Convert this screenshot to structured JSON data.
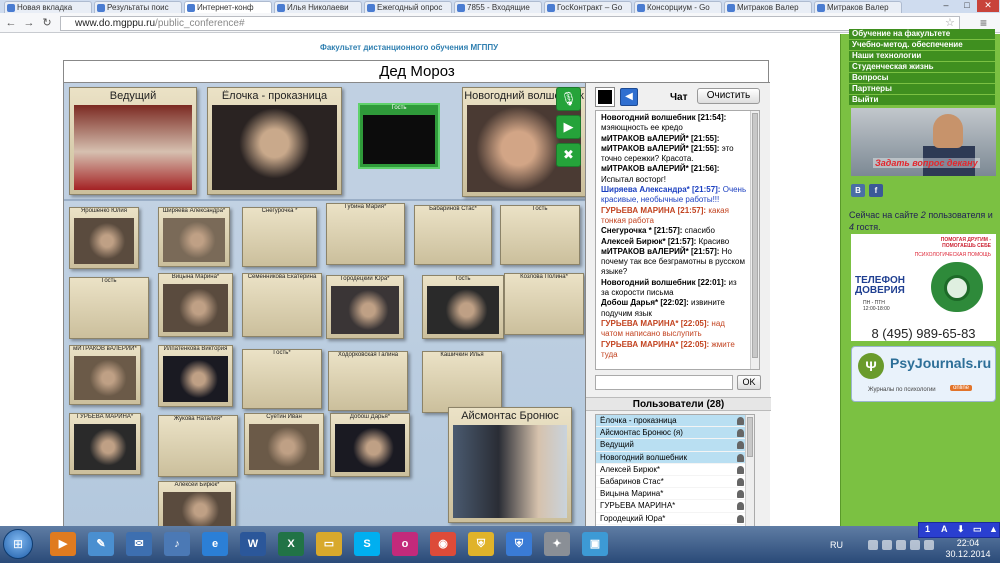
{
  "browser": {
    "tabs": [
      {
        "title": "Новая вкладка",
        "active": false
      },
      {
        "title": "Результаты поис",
        "active": false
      },
      {
        "title": "Интернет-конф",
        "active": true
      },
      {
        "title": "Илья Николаеви",
        "active": false
      },
      {
        "title": "Ежегодный опрос",
        "active": false
      },
      {
        "title": "7855 - Входящие",
        "active": false
      },
      {
        "title": "ГосКонтракт – Go",
        "active": false
      },
      {
        "title": "Консорциум - Go",
        "active": false
      },
      {
        "title": "Митраков Валер",
        "active": false
      },
      {
        "title": "Митраков Валер",
        "active": false
      }
    ],
    "url_host": "www.do.mgppu.ru",
    "url_path": "/public_conference#",
    "controls": {
      "minimize": "–",
      "maximize": "□",
      "close": "✕"
    }
  },
  "page": {
    "faculty": "Факультет дистанционного обучения МГППУ",
    "conference_title": "Дед Мороз",
    "main_speakers": [
      {
        "name": "Ведущий"
      },
      {
        "name": "Ёлочка - проказница"
      }
    ],
    "green_guest": "Гость",
    "wizard": "Новогодний волшебник",
    "tool_icons": [
      "microphone-icon",
      "camera-icon",
      "settings-tools-icon"
    ],
    "participants": [
      {
        "name": "Ярошенко Юлия",
        "cam": true
      },
      {
        "name": "Ширяева Александра*",
        "cam": true
      },
      {
        "name": "Снегурочка *",
        "cam": false
      },
      {
        "name": "Губина Мария*",
        "cam": false
      },
      {
        "name": "Бабаринов Стас*",
        "cam": false
      },
      {
        "name": "Гость",
        "cam": false
      },
      {
        "name": "Гость",
        "cam": false
      },
      {
        "name": "Вицына Марина*",
        "cam": true
      },
      {
        "name": "Семенникова Екатерина",
        "cam": false
      },
      {
        "name": "Городецкий Юра*",
        "cam": true
      },
      {
        "name": "Гость",
        "cam": true
      },
      {
        "name": "Козлова Полина*",
        "cam": false
      },
      {
        "name": "мИТРАКОВ вАЛЕРИЙ*",
        "cam": true
      },
      {
        "name": "Илпатенкова Виктория",
        "cam": true
      },
      {
        "name": "Гость*",
        "cam": false
      },
      {
        "name": "Ходорковская Галина",
        "cam": false
      },
      {
        "name": "Кашичкин Илья",
        "cam": false
      },
      {
        "name": "ГУРЬЕВА МАРИНА*",
        "cam": true
      },
      {
        "name": "Жукова Наталия*",
        "cam": false
      },
      {
        "name": "Суетин Иван",
        "cam": true
      },
      {
        "name": "Добош Дарья*",
        "cam": true
      },
      {
        "name": "Алексей Бирюк*",
        "cam": true
      }
    ],
    "featured": "Айсмонтас Бронюс",
    "chat": {
      "label": "Чат",
      "clear_button": "Очистить",
      "messages": [
        {
          "who": "Новогодний волшебник [21:54]:",
          "text": "мэяющность ее кредо",
          "style": "black"
        },
        {
          "who": "мИТРАКОВ вАЛЕРИЙ* [21:55]:",
          "text": "",
          "style": "black"
        },
        {
          "who": "мИТРАКОВ вАЛЕРИЙ* [21:55]:",
          "text": "это точно сережки? Красота.",
          "style": "black"
        },
        {
          "who": "мИТРАКОВ вАЛЕРИЙ* [21:56]:",
          "text": "Испытал восторг!",
          "style": "black"
        },
        {
          "who": "Ширяева Александра* [21:57]:",
          "text": "Очень красивые, необычные работы!!!",
          "style": "blue"
        },
        {
          "who": "ГУРЬЕВА МАРИНА [21:57]:",
          "text": "какая тонкая работа",
          "style": "red"
        },
        {
          "who": "Снегурочка * [21:57]:",
          "text": "спасибо",
          "style": "black"
        },
        {
          "who": "Алексей Бирюк* [21:57]:",
          "text": "Красиво",
          "style": "black"
        },
        {
          "who": "мИТРАКОВ вАЛЕРИЙ* [21:57]:",
          "text": "Но почему так все безграмотны в русском языке?",
          "style": "black"
        },
        {
          "who": "Новогодний волшебник [22:01]:",
          "text": "из за скорости письма",
          "style": "black"
        },
        {
          "who": "Добош Дарья* [22:02]:",
          "text": "извините подучим язык",
          "style": "black"
        },
        {
          "who": "ГУРЬЕВА МАРИНА* [22:05]:",
          "text": "над чатом написано выслупить",
          "style": "red"
        },
        {
          "who": "ГУРЬЕВА МАРИНА* [22:05]:",
          "text": "жмите туда",
          "style": "red"
        }
      ],
      "ok_button": "OK"
    },
    "users": {
      "title": "Пользователи (28)",
      "list": [
        {
          "name": "Ёлочка - проказница",
          "highlight": true
        },
        {
          "name": "Айсмонтас Бронюс (я)",
          "highlight": true
        },
        {
          "name": "Ведущий",
          "highlight": true
        },
        {
          "name": "Новогодний волшебник",
          "highlight": true
        },
        {
          "name": "Алексей Бирюк*",
          "highlight": false
        },
        {
          "name": "Бабаринов Стас*",
          "highlight": false
        },
        {
          "name": "Вицына Марина*",
          "highlight": false
        },
        {
          "name": "ГУРЬЕВА МАРИНА*",
          "highlight": false
        },
        {
          "name": "Городецкий Юра*",
          "highlight": false
        }
      ]
    }
  },
  "sidebar": {
    "nav": [
      "Обучение на факультете",
      "Учебно-метод. обеспечение",
      "Наши технологии",
      "Студенческая жизнь",
      "Вопросы",
      "Партнеры",
      "Выйти"
    ],
    "promo_text": "Задать вопрос декану",
    "social": [
      {
        "label": "В",
        "color": "#4a6fa5"
      },
      {
        "label": "f",
        "color": "#3b5998"
      }
    ],
    "online_prefix": "Сейчас на сайте",
    "online_count": "2",
    "online_mid": "пользователя и",
    "online_guests": "4",
    "online_suffix": "гостя.",
    "hotline_top1": "ПОМОГАЯ ДРУГИМ -",
    "hotline_top2": "ПОМОГАЕШЬ СЕБЕ",
    "hotline_top3": "ПСИХОЛОГИЧЕСКАЯ ПОМОЩЬ",
    "hotline_title1": "ТЕЛЕФОН",
    "hotline_title2": "ДОВЕРИЯ",
    "hotline_hours1": "ПН - ПТН",
    "hotline_hours2": "12:00-18:00",
    "hotline_number": "8 (495) 989-65-83",
    "psy_brand": "PsyJournals.ru",
    "psy_tagline": "Журналы по психологии",
    "psy_badge": "online"
  },
  "taskbar": {
    "apps": [
      {
        "name": "media-player-icon",
        "glyph": "▶",
        "color": "#e07b1f"
      },
      {
        "name": "paint-icon",
        "glyph": "✎",
        "color": "#4a8fd0"
      },
      {
        "name": "mail-icon",
        "glyph": "✉",
        "color": "#3d6fb0"
      },
      {
        "name": "volume-app-icon",
        "glyph": "♪",
        "color": "#4b79b5"
      },
      {
        "name": "ie-icon",
        "glyph": "e",
        "color": "#2b7fd6"
      },
      {
        "name": "word-icon",
        "glyph": "W",
        "color": "#2b579a"
      },
      {
        "name": "excel-icon",
        "glyph": "X",
        "color": "#217346"
      },
      {
        "name": "folder-icon",
        "glyph": "▭",
        "color": "#d8a92c"
      },
      {
        "name": "skype-icon",
        "glyph": "S",
        "color": "#00aff0"
      },
      {
        "name": "audio-app-icon",
        "glyph": "o",
        "color": "#c32a7b"
      },
      {
        "name": "chrome-icon",
        "glyph": "◉",
        "color": "#dd4b39"
      },
      {
        "name": "shield-icon",
        "glyph": "⛨",
        "color": "#e0b32a"
      },
      {
        "name": "shield2-icon",
        "glyph": "⛨",
        "color": "#3a7bd5"
      },
      {
        "name": "tools-app-icon",
        "glyph": "✦",
        "color": "#8a8f96"
      },
      {
        "name": "picture-icon",
        "glyph": "▣",
        "color": "#3d9ad5"
      }
    ],
    "lang": "RU",
    "time": "22:04",
    "date": "30.12.2014",
    "osk": [
      "1",
      "A",
      "⬇",
      "▭",
      "▲"
    ]
  },
  "colors": {
    "accent_green": "#7bc142",
    "nav_green": "#3f8f1f",
    "chat_blue": "#1b3fc0",
    "chat_red": "#c24320"
  }
}
